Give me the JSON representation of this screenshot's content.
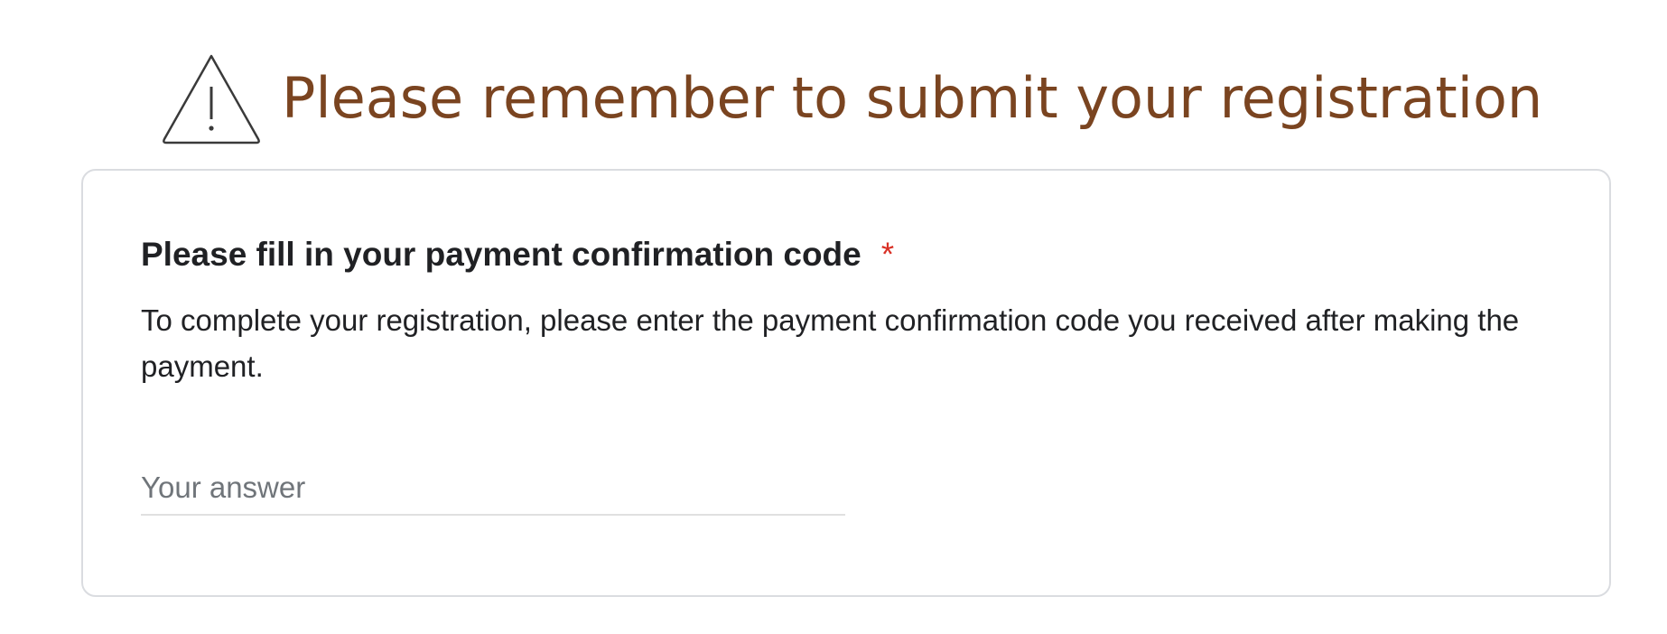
{
  "banner": {
    "icon": "warning-triangle-icon",
    "text": "Please remember to submit your registration",
    "text_color": "#7a4420"
  },
  "question": {
    "title": "Please fill in your payment confirmation code",
    "required_marker": "*",
    "required_color": "#d93025",
    "description": "To complete your registration, please enter the payment confirmation code you received after making the payment.",
    "answer_value": "",
    "answer_placeholder": "Your answer"
  }
}
